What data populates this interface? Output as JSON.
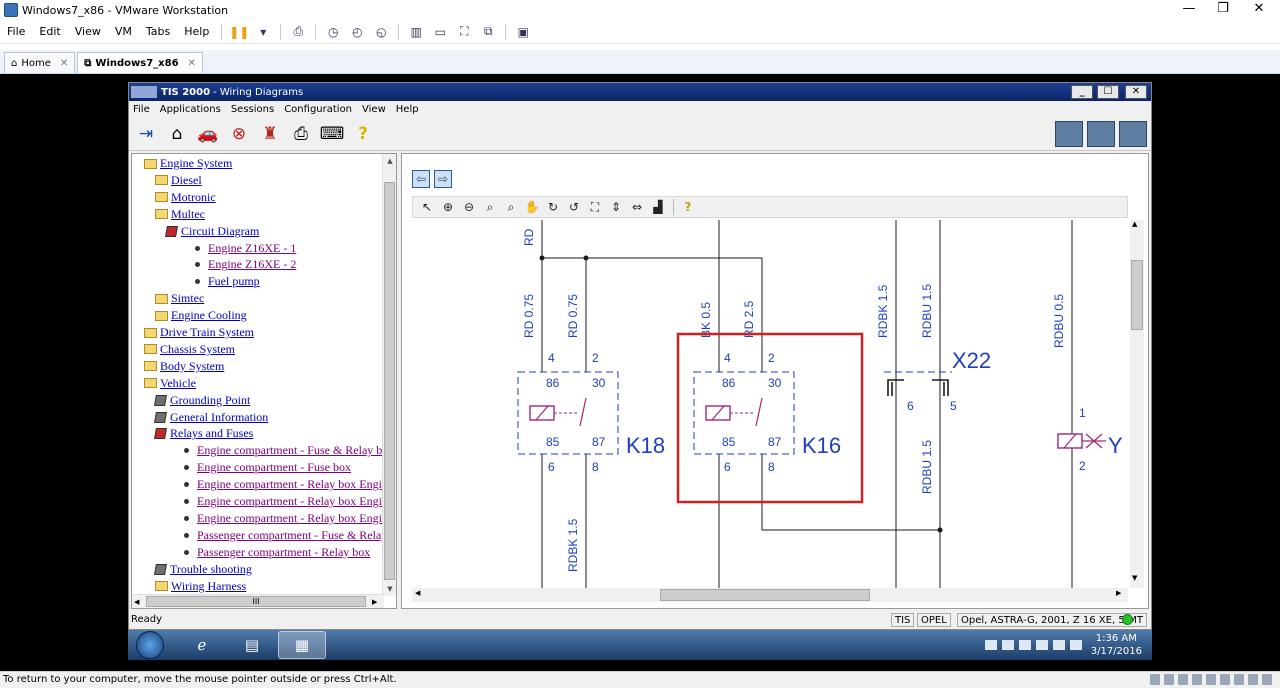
{
  "vm": {
    "title": "Windows7_x86 - VMware Workstation",
    "menu": [
      "File",
      "Edit",
      "View",
      "VM",
      "Tabs",
      "Help"
    ],
    "tabs": [
      {
        "label": "Home",
        "close": "✕"
      },
      {
        "label": "Windows7_x86",
        "close": "✕"
      }
    ],
    "status_text": "To return to your computer, move the mouse pointer outside or press Ctrl+Alt.",
    "window_controls": {
      "minimize": "—",
      "restore": "❐",
      "close": "✕"
    }
  },
  "tis": {
    "title_app": "TIS 2000",
    "title_rest": "- Wiring Diagrams",
    "menu": [
      "File",
      "Applications",
      "Sessions",
      "Configuration",
      "View",
      "Help"
    ],
    "toolbar_icons": [
      "exit-icon",
      "home-icon",
      "vehicle-icon",
      "stop-icon",
      "person-icon",
      "printer-icon",
      "keyboard-icon",
      "help-icon"
    ],
    "window_controls": {
      "minimize": "_",
      "maximize": "☐",
      "close": "✕"
    }
  },
  "tree": {
    "items": [
      {
        "label": "Engine System",
        "icon": "folder-open",
        "indent": 0
      },
      {
        "label": "Diesel",
        "icon": "folder",
        "indent": 1
      },
      {
        "label": "Motronic",
        "icon": "folder",
        "indent": 1
      },
      {
        "label": "Multec",
        "icon": "folder-open",
        "indent": 1
      },
      {
        "label": "Circuit Diagram",
        "icon": "book-red",
        "indent": 2
      },
      {
        "label": "Engine Z16XE - 1",
        "icon": "bullet",
        "indent": 3,
        "visited": true
      },
      {
        "label": "Engine Z16XE - 2",
        "icon": "bullet",
        "indent": 3,
        "visited": true
      },
      {
        "label": "Fuel pump",
        "icon": "bullet",
        "indent": 3
      },
      {
        "label": "Simtec",
        "icon": "folder",
        "indent": 1
      },
      {
        "label": "Engine Cooling",
        "icon": "folder",
        "indent": 1
      },
      {
        "label": "Drive Train System",
        "icon": "folder",
        "indent": 0
      },
      {
        "label": "Chassis System",
        "icon": "folder",
        "indent": 0
      },
      {
        "label": "Body System",
        "icon": "folder",
        "indent": 0
      },
      {
        "label": "Vehicle",
        "icon": "folder-open",
        "indent": 0
      },
      {
        "label": "Grounding Point",
        "icon": "book",
        "indent": 1
      },
      {
        "label": "General Information",
        "icon": "book",
        "indent": 1
      },
      {
        "label": "Relays and Fuses",
        "icon": "book-red",
        "indent": 1
      },
      {
        "label": "Engine compartment - Fuse & Relay box",
        "icon": "bullet",
        "indent": 2,
        "visited": true
      },
      {
        "label": "Engine compartment - Fuse box",
        "icon": "bullet",
        "indent": 2,
        "visited": true
      },
      {
        "label": "Engine compartment - Relay box Engine Y",
        "icon": "bullet",
        "indent": 2,
        "visited": true
      },
      {
        "label": "Engine compartment - Relay box Engine Y",
        "icon": "bullet",
        "indent": 2,
        "visited": true
      },
      {
        "label": "Engine compartment - Relay box Engine Z",
        "icon": "bullet",
        "indent": 2,
        "visited": true
      },
      {
        "label": "Passenger compartment - Fuse & Relay b",
        "icon": "bullet",
        "indent": 2,
        "visited": true
      },
      {
        "label": "Passenger compartment - Relay box",
        "icon": "bullet",
        "indent": 2,
        "visited": true
      },
      {
        "label": "Trouble shooting",
        "icon": "book",
        "indent": 1
      },
      {
        "label": "Wiring Harness",
        "icon": "folder",
        "indent": 1
      }
    ],
    "hscroll_grip": "III"
  },
  "diagram": {
    "wires": {
      "rd": "RD",
      "rd075a": "RD 0.75",
      "rd075b": "RD 0.75",
      "bk05": "BK 0.5",
      "rd25": "RD 2.5",
      "rdbk15_top": "RDBK 1.5",
      "rdbu15_top": "RDBU 1.5",
      "rdbu05": "RDBU 0.5",
      "rdbk15_bot": "RDBK 1.5",
      "rdbu15_bot": "RDBU 1.5"
    },
    "k18": {
      "name": "K18",
      "pins": {
        "p4": "4",
        "p2": "2",
        "p86": "86",
        "p30": "30",
        "p85": "85",
        "p87": "87",
        "p6": "6",
        "p8": "8"
      }
    },
    "k16": {
      "name": "K16",
      "pins": {
        "p4": "4",
        "p2": "2",
        "p86": "86",
        "p30": "30",
        "p85": "85",
        "p87": "87",
        "p6": "6",
        "p8": "8"
      }
    },
    "x22": {
      "name": "X22",
      "pins": {
        "p6": "6",
        "p5": "5"
      }
    },
    "y": {
      "name": "Y",
      "pins": {
        "p1": "1",
        "p2": "2"
      }
    },
    "highlight_color": "#d42020",
    "line_color": "#1a1a1a",
    "label_color": "#1f3fbf",
    "component_color": "#a0287a"
  },
  "tis_status": {
    "left": "Ready",
    "cells": [
      "TIS",
      "OPEL",
      "Opel, ASTRA-G, 2001, Z 16 XE, 5-MT"
    ]
  },
  "taskbar": {
    "time": "1:36 AM",
    "date": "3/17/2016"
  }
}
